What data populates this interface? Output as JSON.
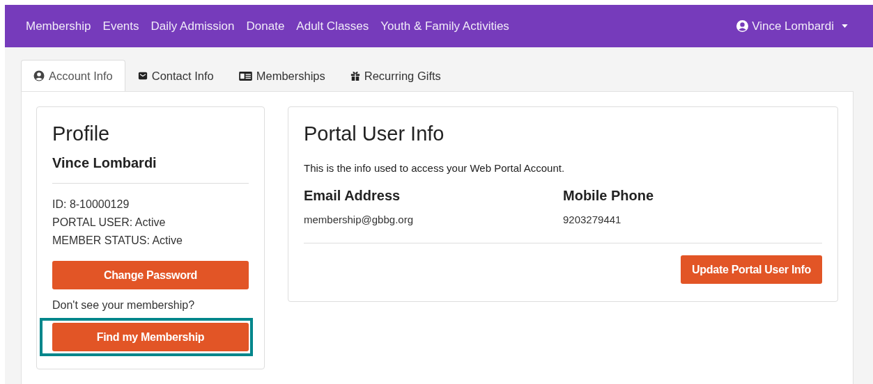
{
  "navbar": {
    "links": [
      "Membership",
      "Events",
      "Daily Admission",
      "Donate",
      "Adult Classes",
      "Youth & Family Activities"
    ],
    "user": "Vince Lombardi"
  },
  "tabs": [
    {
      "label": "Account Info",
      "kind": "account",
      "selected": true
    },
    {
      "label": "Contact Info",
      "kind": "contact",
      "selected": false
    },
    {
      "label": "Memberships",
      "kind": "memberships",
      "selected": false
    },
    {
      "label": "Recurring Gifts",
      "kind": "gifts",
      "selected": false
    }
  ],
  "profile": {
    "title": "Profile",
    "name": "Vince Lombardi",
    "details": [
      "ID: 8-10000129",
      "PORTAL USER: Active",
      "MEMBER STATUS: Active"
    ],
    "change_password_button": {
      "label": "Change Password"
    },
    "prompt": "Don't see your membership?",
    "find_membership_button": {
      "label": "Find my Membership",
      "highlighted": true
    }
  },
  "portal_user_info": {
    "title": "Portal User Info",
    "description": "This is the info used to access your Web Portal Account.",
    "fields": [
      {
        "label": "Email Address",
        "value": "membership@gbbg.org"
      },
      {
        "label": "Mobile Phone",
        "value": "9203279441"
      }
    ],
    "update_button": "Update Portal User Info"
  }
}
